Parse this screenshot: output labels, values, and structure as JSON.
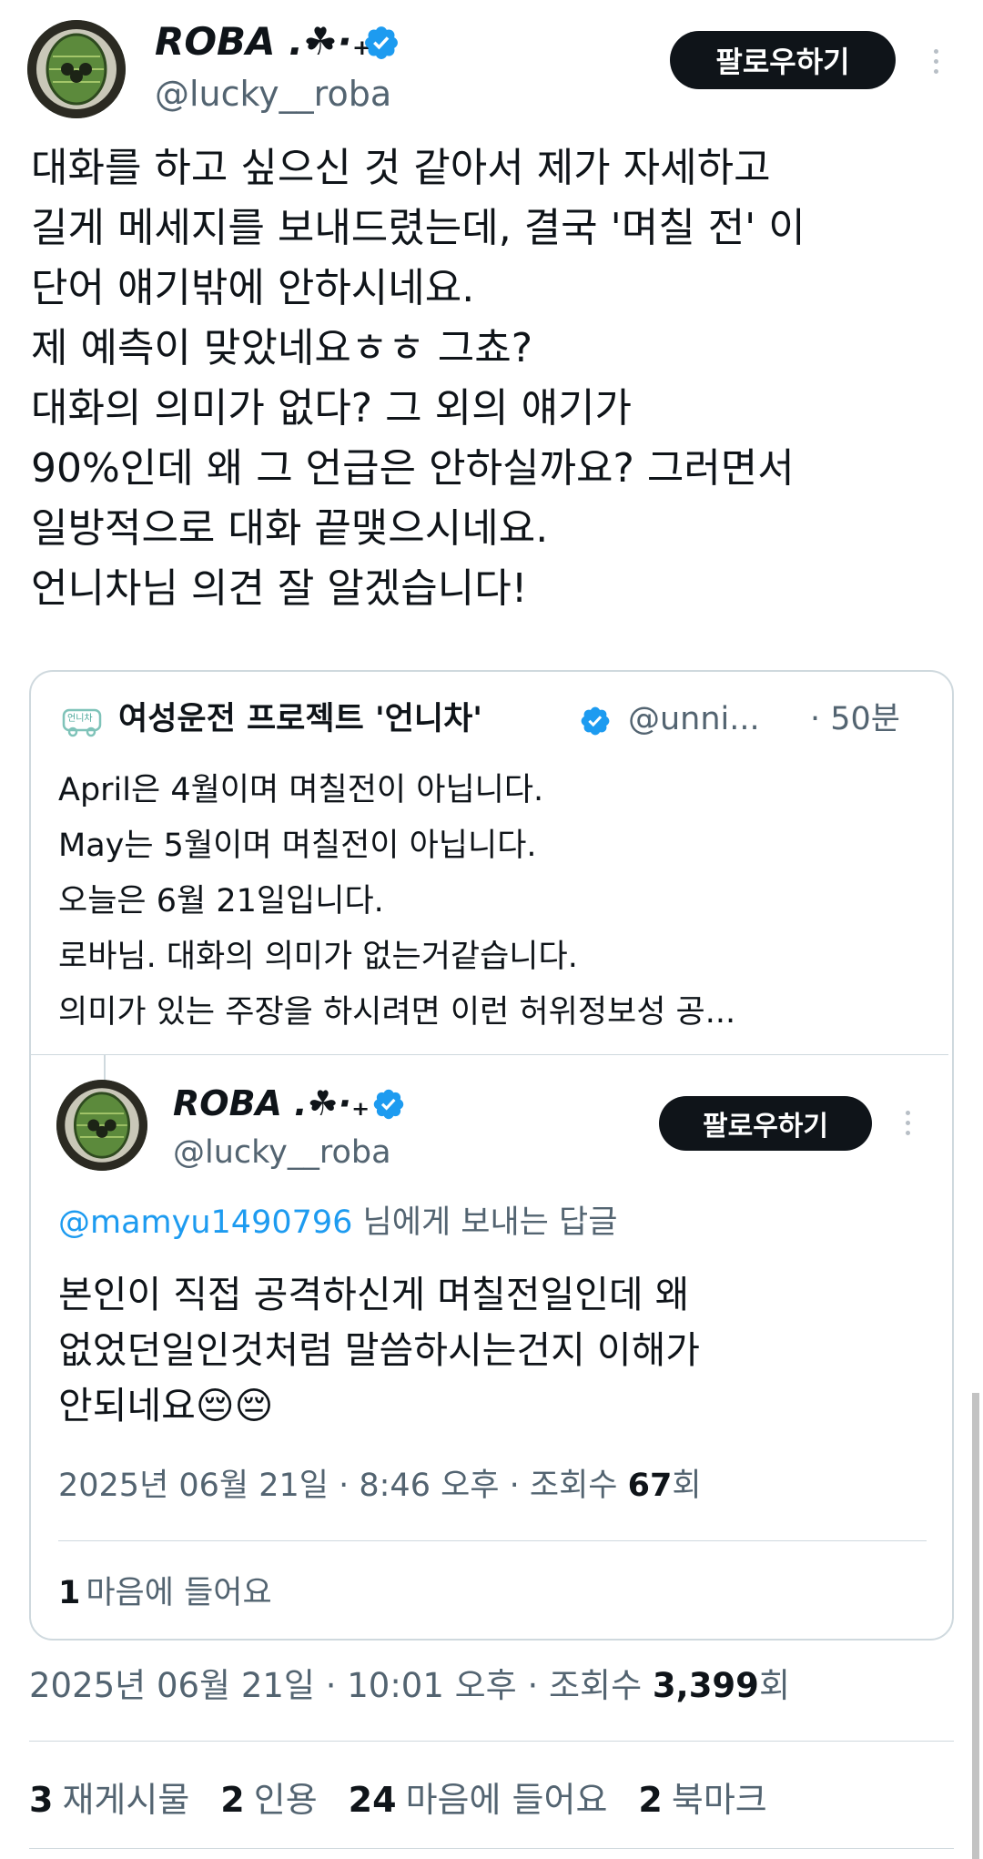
{
  "post": {
    "author_name": "ROBA .☘︎·₊",
    "author_handle": "@lucky__roba",
    "follow_label": "팔로우하기",
    "lines": [
      "대화를 하고 싶으신 것 같아서 제가 자세하고",
      "길게 메세지를 보내드렸는데, 결국 '며칠 전' 이",
      "단어 얘기밖에 안하시네요.",
      "제 예측이 맞았네요ㅎㅎ 그쵸?",
      "대화의 의미가 없다? 그 외의 얘기가",
      "90%인데 왜 그 언급은 안하실까요? 그러면서",
      "일방적으로 대화 끝맺으시네요.",
      "언니차님 의견 잘 알겠습니다!"
    ],
    "timestamp": "2025년 06월 21일 · 10:01 오후 · 조회수 ",
    "views": "3,399",
    "views_suffix": "회",
    "stats": {
      "reposts_count": "3",
      "reposts_label": "재게시물",
      "quotes_count": "2",
      "quotes_label": "인용",
      "likes_count": "24",
      "likes_label": "마음에 들어요",
      "bookmarks_count": "2",
      "bookmarks_label": "북마크"
    }
  },
  "quoted": {
    "logo_text": "언니차",
    "name": "여성운전 프로젝트 '언니차'",
    "handle": "@unni...",
    "time": "· 50분",
    "lines": [
      "April은 4월이며 며칠전이 아닙니다.",
      "May는 5월이며 며칠전이 아닙니다.",
      "오늘은 6월 21일입니다.",
      "로바님. 대화의 의미가 없는거같습니다.",
      "의미가 있는 주장을 하시려면 이런 허위정보성 공..."
    ]
  },
  "nested": {
    "author_name": "ROBA .☘︎·₊",
    "author_handle": "@lucky__roba",
    "follow_label": "팔로우하기",
    "reply_to_handle": "@mamyu1490796",
    "reply_to_suffix": " 님에게 보내는 답글",
    "lines": [
      "본인이 직접 공격하신게 며칠전일인데 왜",
      "없었던일인것처럼 말씀하시는건지 이해가",
      "안되네요😔😔"
    ],
    "timestamp": "2025년 06월 21일 · 8:46 오후 · 조회수 ",
    "views": "67",
    "views_suffix": "회",
    "likes_count": "1",
    "likes_label": "마음에 들어요"
  },
  "colors": {
    "verified": "#1d9bf0",
    "link": "#1d9bf0",
    "muted": "#536471",
    "text": "#0f1419"
  }
}
